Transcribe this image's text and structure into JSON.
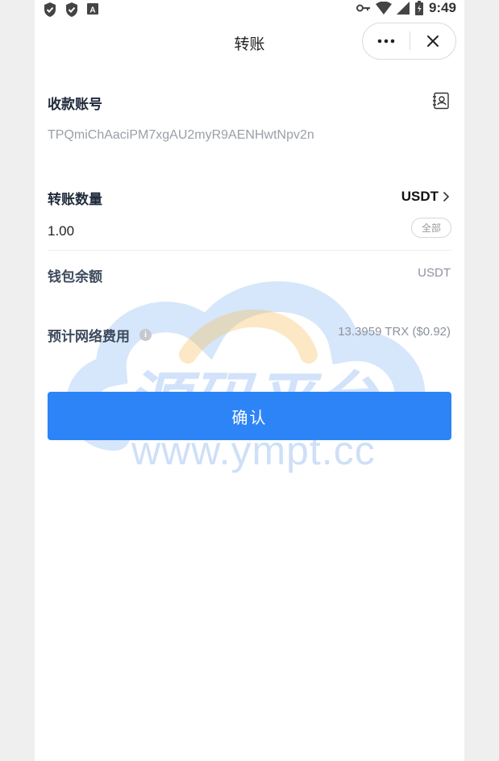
{
  "status_bar": {
    "time": "9:49",
    "left_icons": [
      "shield-icon",
      "shield-icon",
      "app-a-icon"
    ],
    "right_icons": [
      "key-icon",
      "wifi-icon",
      "signal-icon",
      "battery-icon"
    ]
  },
  "title_bar": {
    "title": "转账",
    "more_icon": "more-dots-icon",
    "close_icon": "close-icon"
  },
  "recipient": {
    "label": "收款账号",
    "address": "TPQmiChAaciPM7xgAU2myR9AENHwtNpv2n",
    "contacts_icon": "contacts-book-icon"
  },
  "amount_section": {
    "label": "转账数量",
    "token": "USDT",
    "token_icon": "chevron-right-icon",
    "value": "1.00",
    "all_button": "全部"
  },
  "balance": {
    "label": "钱包余额",
    "value": "USDT"
  },
  "fee": {
    "label": "预计网络费用",
    "info_icon": "info-icon",
    "value": "13.3959 TRX ($0.92)"
  },
  "confirm_button": "确认",
  "watermark": {
    "text": "源码平台",
    "url": "www.ympt.cc"
  },
  "colors": {
    "primary": "#2d84f7",
    "label": "#1f2a3a",
    "muted": "#9aa0a8",
    "background": "#efefef"
  }
}
